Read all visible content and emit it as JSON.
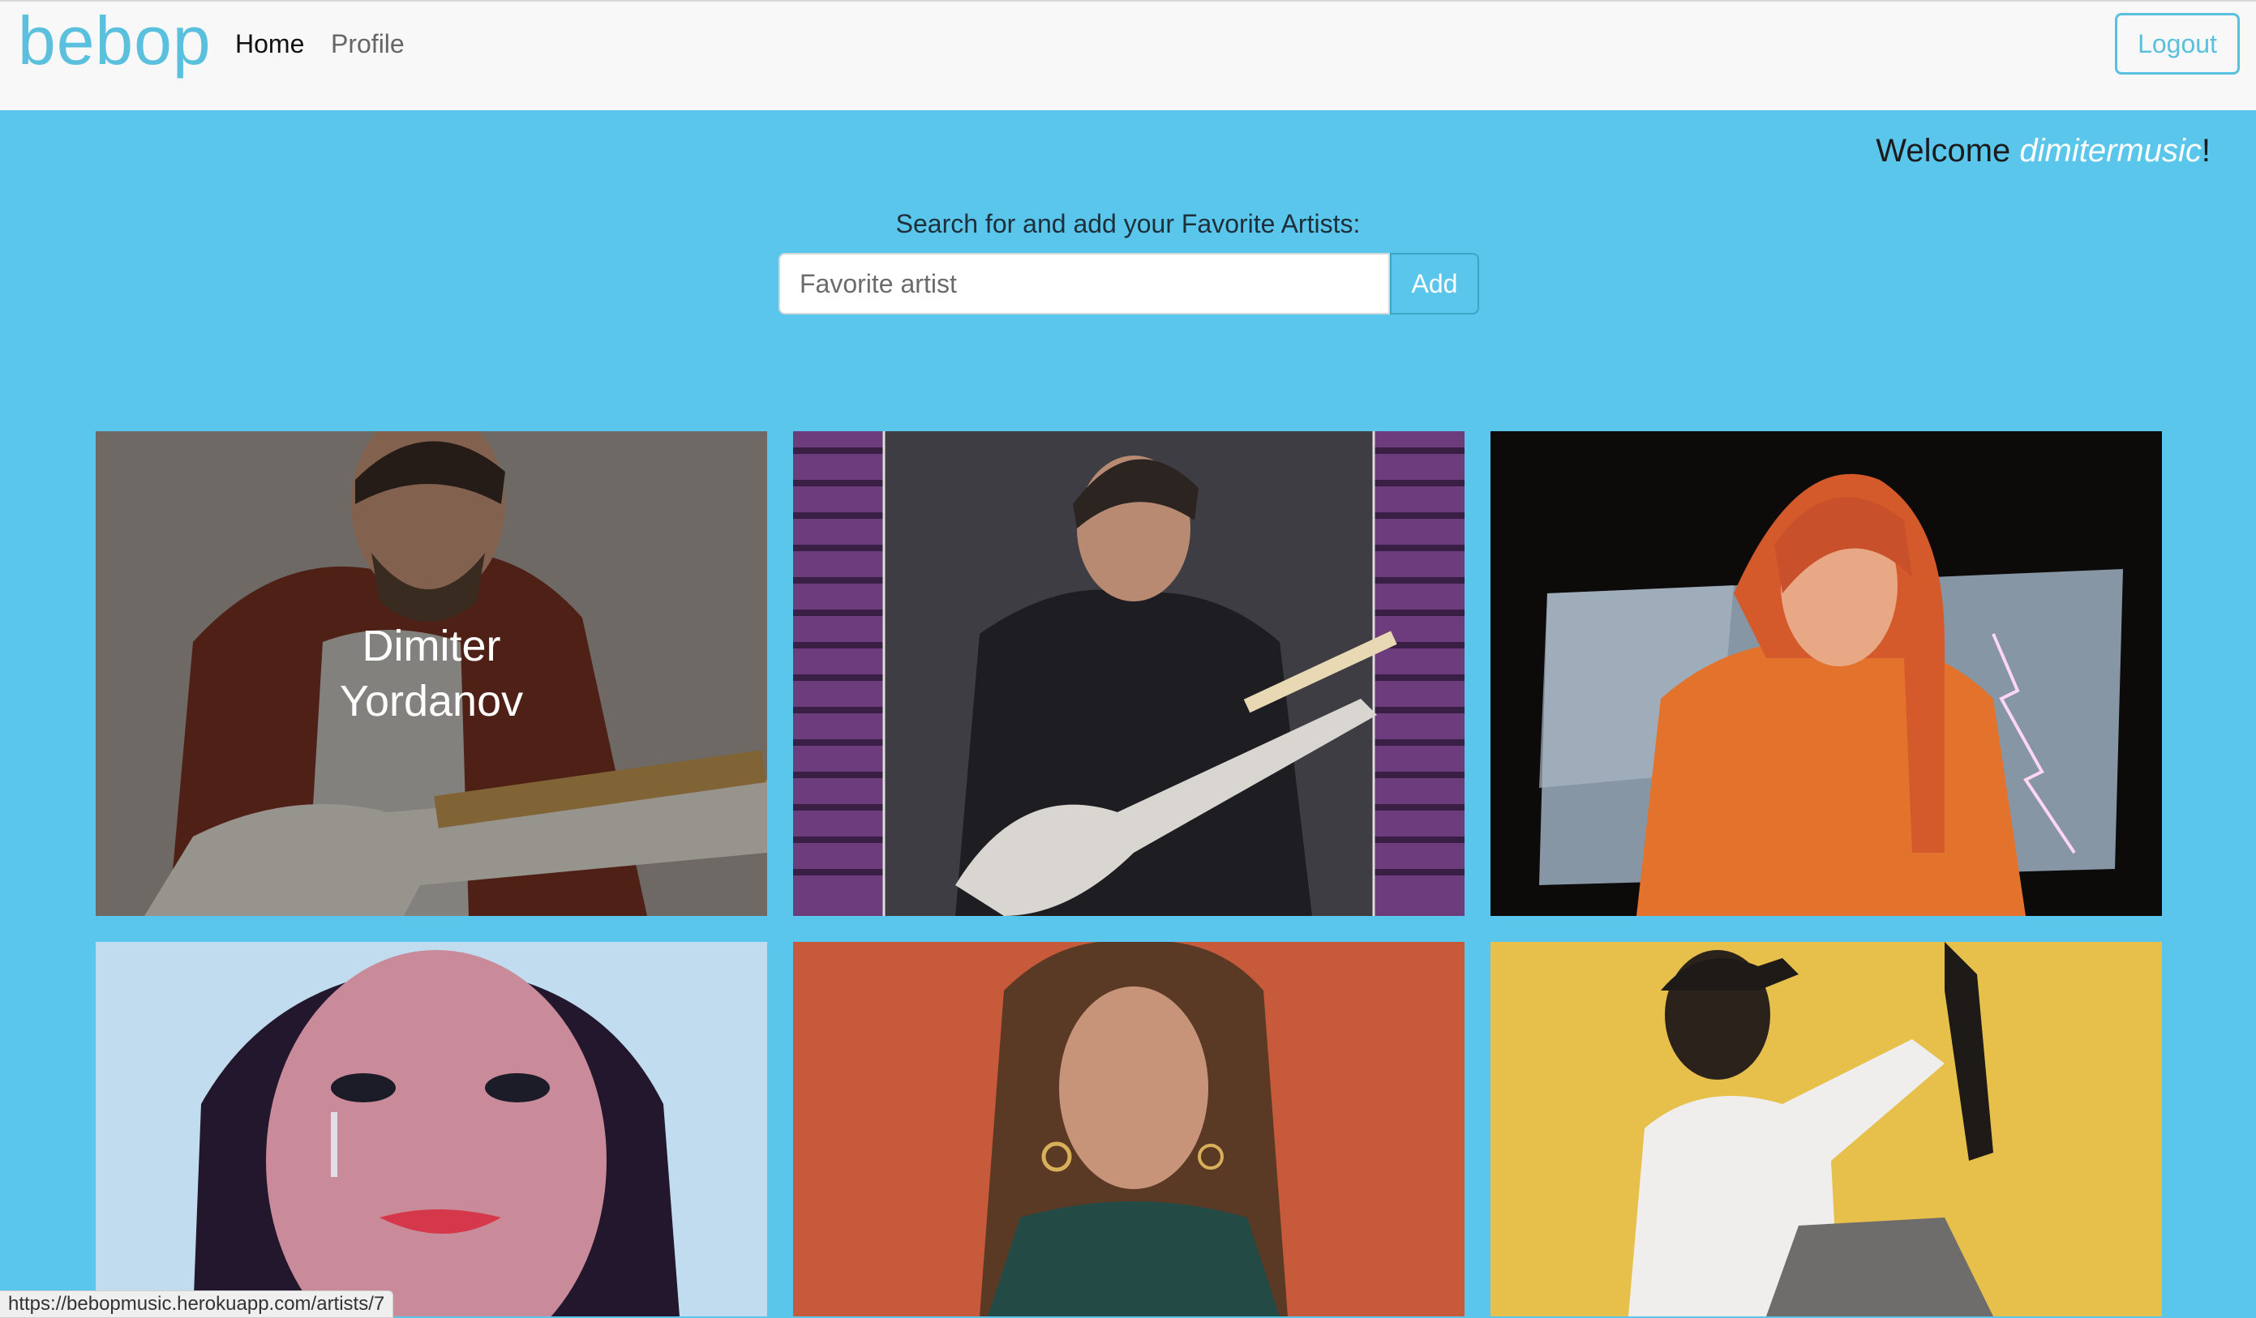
{
  "app": {
    "brand": "bebop"
  },
  "nav": {
    "home": "Home",
    "profile": "Profile",
    "logout": "Logout"
  },
  "welcome": {
    "prefix": "Welcome ",
    "username": "dimitermusic",
    "suffix": "!"
  },
  "search": {
    "label": "Search for and add your Favorite Artists:",
    "placeholder": "Favorite artist",
    "add_label": "Add"
  },
  "artists": [
    {
      "name": "Dimiter Yordanov",
      "name_line1": "Dimiter",
      "name_line2": "Yordanov",
      "hovered": true
    },
    {
      "name": ""
    },
    {
      "name": ""
    },
    {
      "name": ""
    },
    {
      "name": ""
    },
    {
      "name": ""
    }
  ],
  "status_bar": {
    "url": "https://bebopmusic.herokuapp.com/artists/7"
  },
  "colors": {
    "accent": "#5bc0de",
    "background": "#5bc6ec",
    "navbar": "#f8f8f9"
  }
}
